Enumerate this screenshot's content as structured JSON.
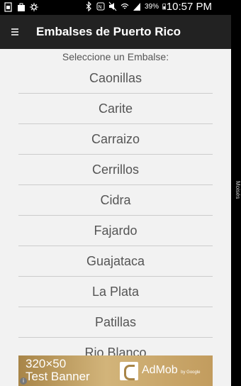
{
  "status_bar": {
    "battery_percent": "39%",
    "time": "10:57 PM",
    "icons": [
      "sim-icon",
      "shopping-bag-icon",
      "settings-icon",
      "bluetooth-icon",
      "nfc-icon",
      "mute-icon",
      "wifi-icon",
      "signal-icon",
      "battery-icon"
    ]
  },
  "app_bar": {
    "title": "Embalses de Puerto Rico",
    "menu_icon": "menu-icon"
  },
  "main": {
    "prompt": "Seleccione un Embalse:",
    "reservoirs": [
      "Caonillas",
      "Carite",
      "Carraizo",
      "Cerrillos",
      "Cidra",
      "Fajardo",
      "Guajataca",
      "La Plata",
      "Patillas",
      "Rio Blanco"
    ]
  },
  "ad_banner": {
    "text_line1": "320×50",
    "text_line2": "Test Banner",
    "brand": "AdMob",
    "brand_sub": "by Google",
    "info_icon": "info-icon"
  },
  "side_label": "Moisés",
  "colors": {
    "app_bar_bg": "#222222",
    "content_bg": "#f2f2f2",
    "text_gray": "#555555",
    "divider": "#cccccc"
  }
}
